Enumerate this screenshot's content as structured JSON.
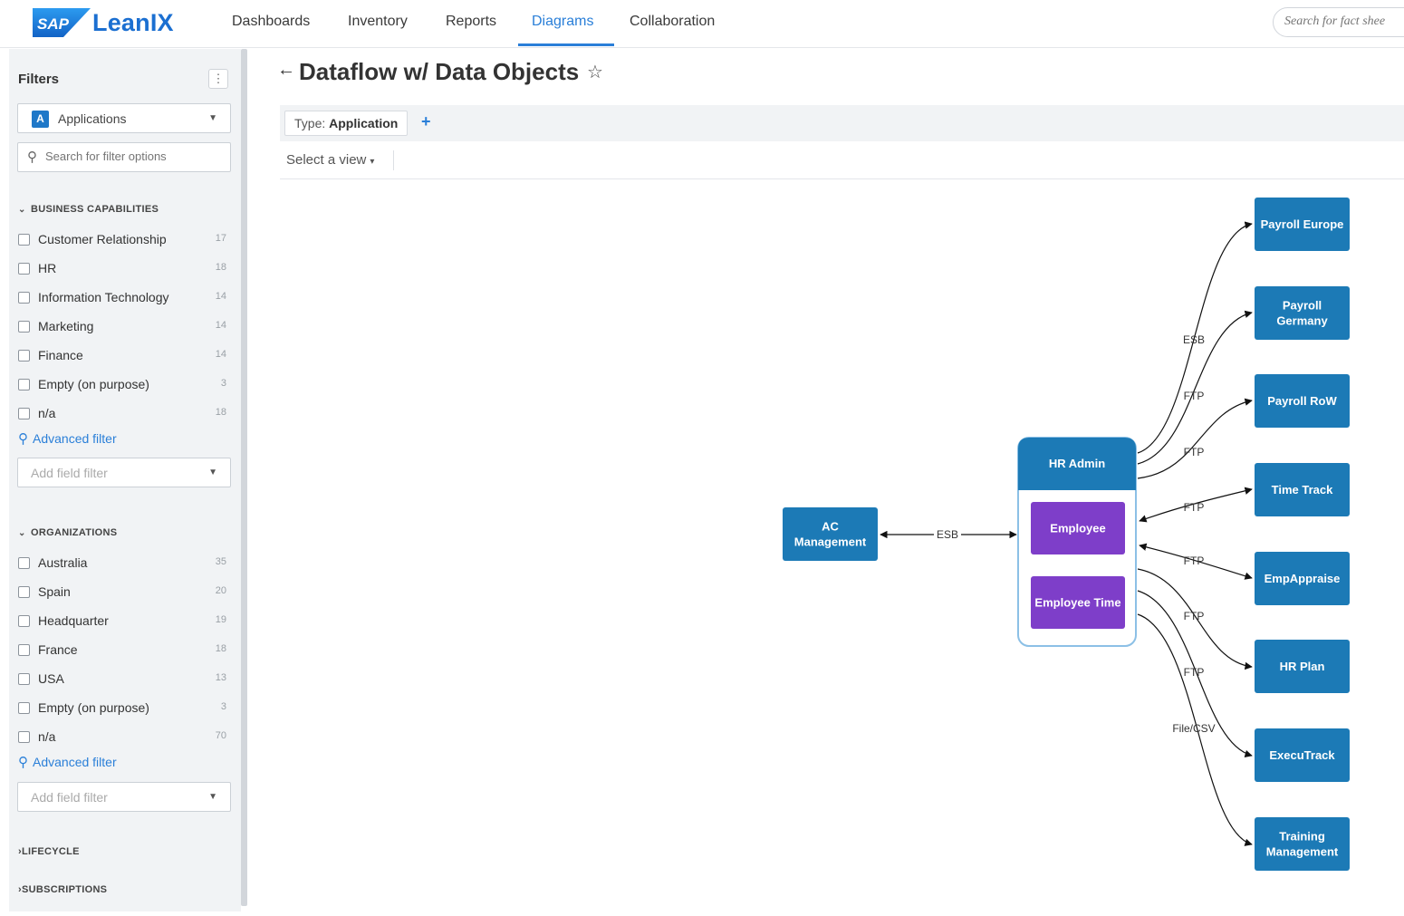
{
  "app": {
    "logo_badge": "SAP",
    "logo_text": "LeanIX",
    "brand_color": "#1b6fd1",
    "accent_color": "#2a7fd8"
  },
  "nav": {
    "items": [
      "Dashboards",
      "Inventory",
      "Reports",
      "Diagrams",
      "Collaboration"
    ],
    "active": "Diagrams",
    "search_placeholder": "Search for fact shee"
  },
  "sidebar": {
    "title": "Filters",
    "menu_icon": "more-vertical-icon",
    "type_select": {
      "icon_letter": "A",
      "label": "Applications"
    },
    "search_placeholder": "Search for filter options",
    "business_capabilities": {
      "title": "BUSINESS CAPABILITIES",
      "expanded": true,
      "items": [
        {
          "label": "Customer Relationship",
          "count": "17"
        },
        {
          "label": "HR",
          "count": "18"
        },
        {
          "label": "Information Technology",
          "count": "14"
        },
        {
          "label": "Marketing",
          "count": "14"
        },
        {
          "label": "Finance",
          "count": "14"
        },
        {
          "label": "Empty (on purpose)",
          "count": "3"
        },
        {
          "label": "n/a",
          "count": "18"
        }
      ],
      "advanced_filter": "Advanced filter",
      "field_filter_placeholder": "Add field filter"
    },
    "organizations": {
      "title": "ORGANIZATIONS",
      "expanded": true,
      "items": [
        {
          "label": "Australia",
          "count": "35"
        },
        {
          "label": "Spain",
          "count": "20"
        },
        {
          "label": "Headquarter",
          "count": "19"
        },
        {
          "label": "France",
          "count": "18"
        },
        {
          "label": "USA",
          "count": "13"
        },
        {
          "label": "Empty (on purpose)",
          "count": "3"
        },
        {
          "label": "n/a",
          "count": "70"
        }
      ],
      "advanced_filter": "Advanced filter",
      "field_filter_placeholder": "Add field filter"
    },
    "lifecycle": {
      "title": "LIFECYCLE",
      "expanded": false
    },
    "subscriptions": {
      "title": "SUBSCRIPTIONS",
      "expanded": false
    }
  },
  "main": {
    "title": "Dataflow w/ Data Objects",
    "type_filter": {
      "prefix": "Type:",
      "value": "Application"
    },
    "add_filter_symbol": "+",
    "view_select": "Select a view"
  },
  "diagram": {
    "app_color": "#1c7ab6",
    "data_object_color": "#7e3ec9",
    "nodes": [
      {
        "id": "ac",
        "lines": [
          "AC",
          "Management"
        ]
      },
      {
        "id": "hr-admin",
        "lines": [
          "HR Admin"
        ]
      },
      {
        "id": "employee",
        "lines": [
          "Employee"
        ],
        "kind": "data-object"
      },
      {
        "id": "employee-time",
        "lines": [
          "Employee Time"
        ],
        "kind": "data-object"
      },
      {
        "id": "payroll-europe",
        "lines": [
          "Payroll Europe"
        ]
      },
      {
        "id": "payroll-germany",
        "lines": [
          "Payroll",
          "Germany"
        ]
      },
      {
        "id": "payroll-row",
        "lines": [
          "Payroll RoW"
        ]
      },
      {
        "id": "time-track",
        "lines": [
          "Time Track"
        ]
      },
      {
        "id": "empappraise",
        "lines": [
          "EmpAppraise"
        ]
      },
      {
        "id": "hr-plan",
        "lines": [
          "HR Plan"
        ]
      },
      {
        "id": "executrack",
        "lines": [
          "ExecuTrack"
        ]
      },
      {
        "id": "training",
        "lines": [
          "Training",
          "Management"
        ]
      }
    ],
    "edges": [
      {
        "from": "ac",
        "to": "hr-admin",
        "label": "ESB",
        "direction": "both"
      },
      {
        "from": "hr-admin",
        "to": "payroll-europe",
        "label": "ESB",
        "direction": "forward"
      },
      {
        "from": "hr-admin",
        "to": "payroll-germany",
        "label": "FTP",
        "direction": "forward"
      },
      {
        "from": "hr-admin",
        "to": "payroll-row",
        "label": "FTP",
        "direction": "forward"
      },
      {
        "from": "hr-admin",
        "to": "time-track",
        "label": "FTP",
        "direction": "both"
      },
      {
        "from": "empappraise",
        "to": "hr-admin",
        "label": "FTP",
        "direction": "both"
      },
      {
        "from": "hr-admin",
        "to": "hr-plan",
        "label": "FTP",
        "direction": "forward"
      },
      {
        "from": "hr-admin",
        "to": "executrack",
        "label": "FTP",
        "direction": "forward"
      },
      {
        "from": "hr-admin",
        "to": "training",
        "label": "File/CSV",
        "direction": "forward"
      }
    ]
  }
}
